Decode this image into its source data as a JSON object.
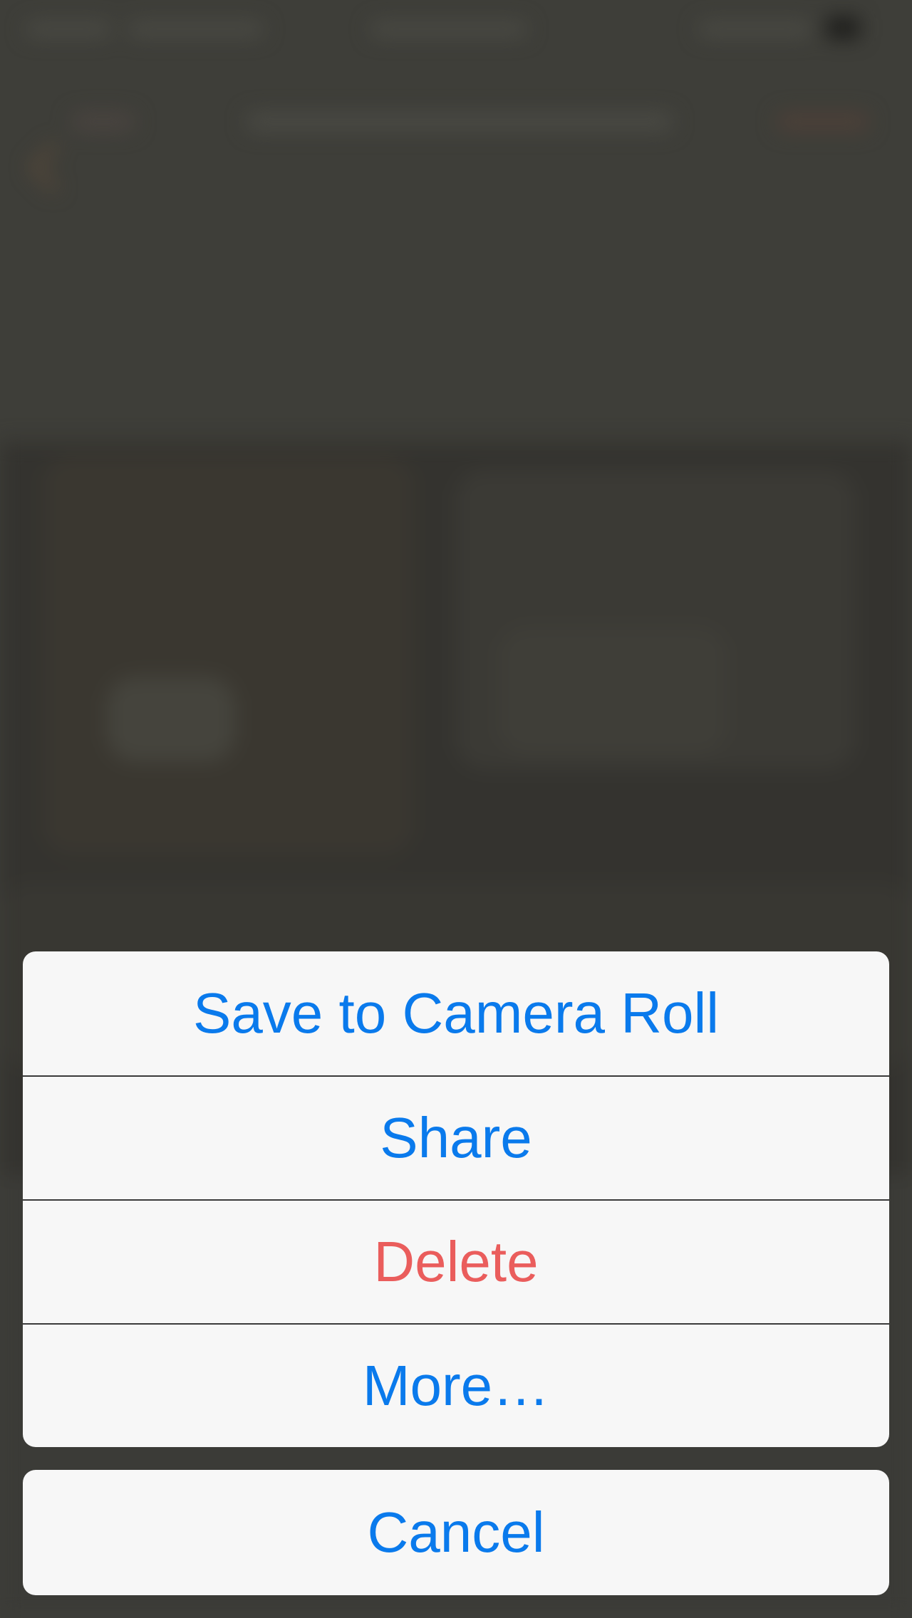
{
  "colors": {
    "action_blue": "#0a7aec",
    "destructive_red": "#ea5d5c",
    "sheet_background": "#f7f7f7",
    "dimmed_backdrop": "#3e3e39"
  },
  "action_sheet": {
    "items": [
      {
        "label": "Save to Camera Roll",
        "style": "default"
      },
      {
        "label": "Share",
        "style": "default"
      },
      {
        "label": "Delete",
        "style": "destructive"
      },
      {
        "label": "More…",
        "style": "default"
      }
    ],
    "cancel_label": "Cancel"
  }
}
